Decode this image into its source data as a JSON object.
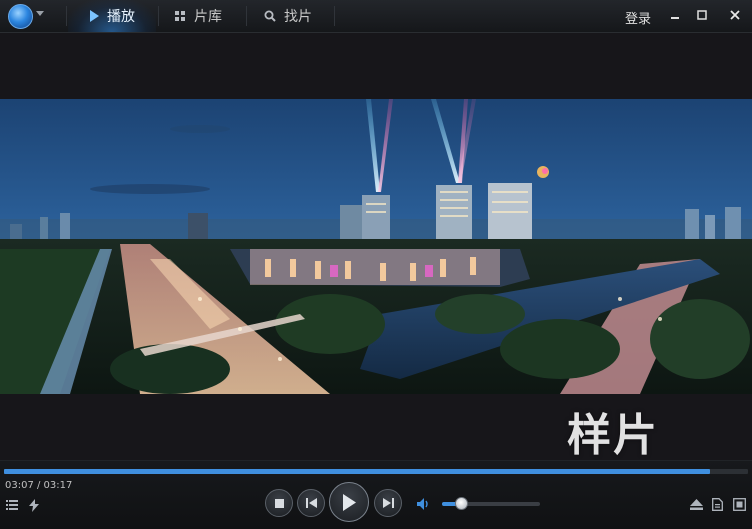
{
  "app": {
    "tabs": [
      {
        "label": "播放",
        "icon": "play-icon",
        "active": true
      },
      {
        "label": "片库",
        "icon": "grid-icon",
        "active": false
      },
      {
        "label": "找片",
        "icon": "search-icon",
        "active": false
      }
    ],
    "login_label": "登录"
  },
  "video": {
    "watermark": "样片"
  },
  "player": {
    "time_display": "03:07 / 03:17",
    "progress": 0.949,
    "volume": 0.19
  },
  "colors": {
    "accent": "#3f8fdf",
    "active_tab_glow": "#328ce6"
  }
}
